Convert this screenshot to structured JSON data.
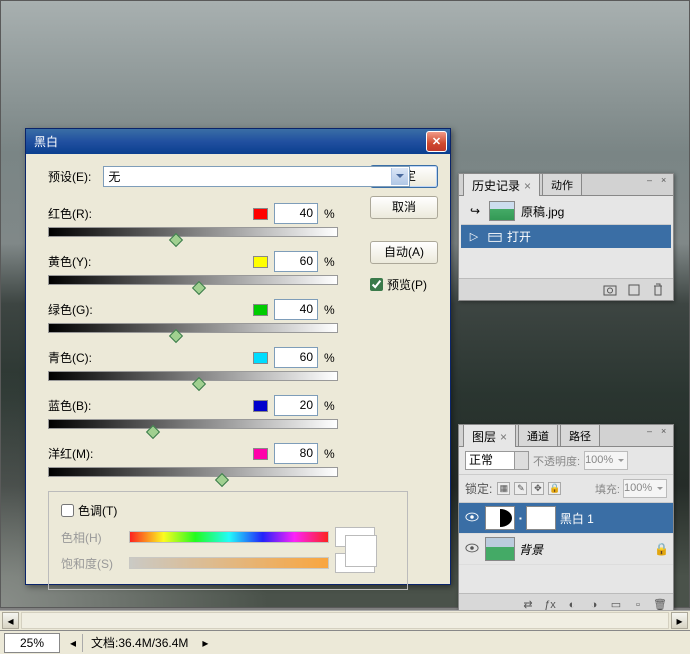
{
  "bw_dialog": {
    "title": "黑白",
    "preset_label": "预设(E):",
    "preset_value": "无",
    "buttons": {
      "ok": "确定",
      "cancel": "取消",
      "auto": "自动(A)"
    },
    "preview_label": "预览(P)",
    "sliders": [
      {
        "label": "红色(R):",
        "color": "#ff0000",
        "value": "40"
      },
      {
        "label": "黄色(Y):",
        "color": "#ffff00",
        "value": "60"
      },
      {
        "label": "绿色(G):",
        "color": "#00cc00",
        "value": "40"
      },
      {
        "label": "青色(C):",
        "color": "#00ddff",
        "value": "60"
      },
      {
        "label": "蓝色(B):",
        "color": "#0000cc",
        "value": "20"
      },
      {
        "label": "洋红(M):",
        "color": "#ff00aa",
        "value": "80"
      }
    ],
    "pct": "%",
    "tint": {
      "checkbox_label": "色调(T)",
      "hue_label": "色相(H)",
      "sat_label": "饱和度(S)"
    }
  },
  "history_panel": {
    "tabs": {
      "history": "历史记录",
      "actions": "动作"
    },
    "doc_name": "原稿.jpg",
    "items": [
      {
        "label": "打开"
      }
    ]
  },
  "layers_panel": {
    "tabs": {
      "layers": "图层",
      "channels": "通道",
      "paths": "路径"
    },
    "blend_mode": "正常",
    "opacity_label": "不透明度:",
    "opacity_value": "100%",
    "lock_label": "锁定:",
    "fill_label": "填充:",
    "fill_value": "100%",
    "rows": [
      {
        "name": "黑白 1"
      },
      {
        "name": "背景"
      }
    ]
  },
  "status": {
    "zoom": "25%",
    "doc_label": "文档:",
    "doc_size": "36.4M/36.4M"
  }
}
